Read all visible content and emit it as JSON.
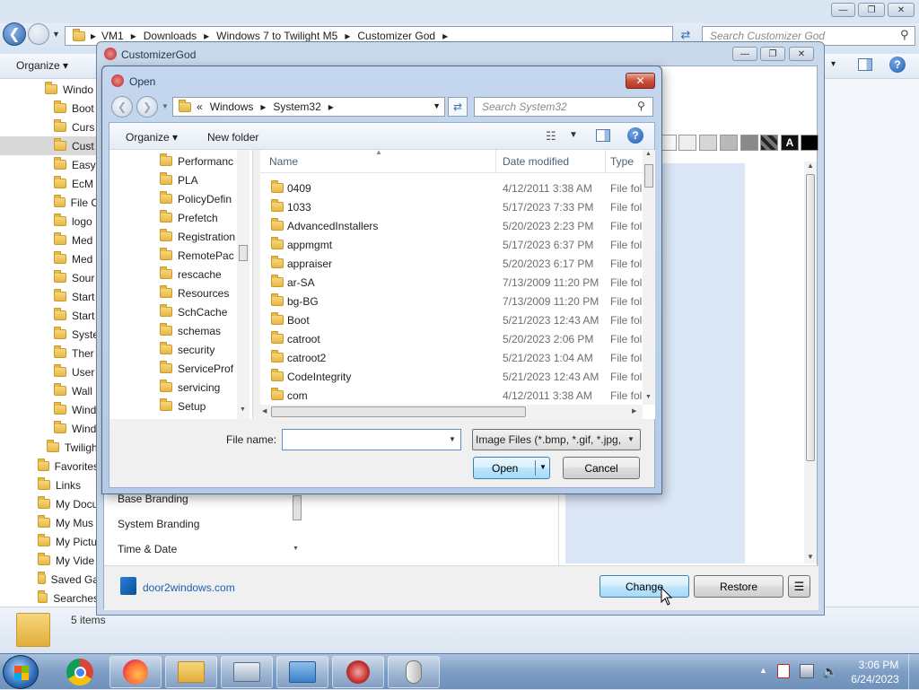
{
  "explorer": {
    "breadcrumb": [
      "VM1",
      "Downloads",
      "Windows 7 to Twilight M5",
      "Customizer God"
    ],
    "search_placeholder": "Search Customizer God",
    "organize_label": "Organize",
    "tree_items": [
      "Windo",
      "Boot",
      "Curs",
      "Cust",
      "Easy",
      "EcM",
      "File C",
      "logo",
      "Med",
      "Med",
      "Sour",
      "Start",
      "Start",
      "Syste",
      "Ther",
      "User",
      "Wall",
      "Wind",
      "Wind",
      "Twiligh",
      "Favorites",
      "Links",
      "My Docu",
      "My Mus",
      "My Pictu",
      "My Vide",
      "Saved Ga",
      "Searches"
    ],
    "status_text": "5 items"
  },
  "customizer": {
    "title": "CustomizerGod",
    "menu_items": [
      "Base Branding",
      "System Branding",
      "Time & Date"
    ],
    "website_link": "door2windows.com",
    "change_label": "Change",
    "restore_label": "Restore"
  },
  "dialog": {
    "title": "Open",
    "breadcrumb_prefix": "«",
    "breadcrumb": [
      "Windows",
      "System32"
    ],
    "search_placeholder": "Search System32",
    "organize_label": "Organize",
    "new_folder_label": "New folder",
    "nav_folders": [
      "Performanc",
      "PLA",
      "PolicyDefin",
      "Prefetch",
      "Registration",
      "RemotePac",
      "rescache",
      "Resources",
      "SchCache",
      "schemas",
      "security",
      "ServiceProf",
      "servicing",
      "Setup"
    ],
    "columns": {
      "name": "Name",
      "date": "Date modified",
      "type": "Type"
    },
    "files": [
      {
        "name": "0409",
        "date": "4/12/2011 3:38 AM",
        "type": "File fol"
      },
      {
        "name": "1033",
        "date": "5/17/2023 7:33 PM",
        "type": "File fol"
      },
      {
        "name": "AdvancedInstallers",
        "date": "5/20/2023 2:23 PM",
        "type": "File fol"
      },
      {
        "name": "appmgmt",
        "date": "5/17/2023 6:37 PM",
        "type": "File fol"
      },
      {
        "name": "appraiser",
        "date": "5/20/2023 6:17 PM",
        "type": "File fol"
      },
      {
        "name": "ar-SA",
        "date": "7/13/2009 11:20 PM",
        "type": "File fol"
      },
      {
        "name": "bg-BG",
        "date": "7/13/2009 11:20 PM",
        "type": "File fol"
      },
      {
        "name": "Boot",
        "date": "5/21/2023 12:43 AM",
        "type": "File fol"
      },
      {
        "name": "catroot",
        "date": "5/20/2023 2:06 PM",
        "type": "File fol"
      },
      {
        "name": "catroot2",
        "date": "5/21/2023 1:04 AM",
        "type": "File fol"
      },
      {
        "name": "CodeIntegrity",
        "date": "5/21/2023 12:43 AM",
        "type": "File fol"
      },
      {
        "name": "com",
        "date": "4/12/2011 3:38 AM",
        "type": "File fol"
      }
    ],
    "filename_label": "File name:",
    "filename_value": "",
    "filter_value": "Image Files (*.bmp, *.gif, *.jpg,",
    "open_label": "Open",
    "cancel_label": "Cancel"
  },
  "taskbar": {
    "time": "3:06 PM",
    "date": "6/24/2023"
  }
}
